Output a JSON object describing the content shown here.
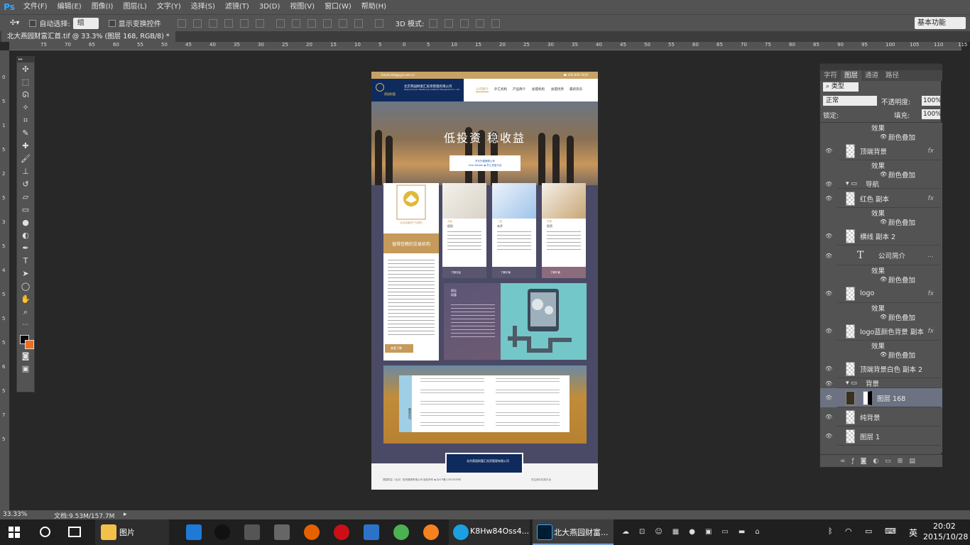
{
  "menubar": {
    "logo": "Ps",
    "items": [
      "文件(F)",
      "编辑(E)",
      "图像(I)",
      "图层(L)",
      "文字(Y)",
      "选择(S)",
      "滤镜(T)",
      "3D(D)",
      "视图(V)",
      "窗口(W)",
      "帮助(H)"
    ]
  },
  "options": {
    "auto_select_label": "自动选择:",
    "auto_select_value": "组",
    "show_transform_label": "显示变换控件",
    "mode_3d_label": "3D 模式:",
    "workspace": "基本功能"
  },
  "document_tab": "北大燕园财富汇首.tif @ 33.3% (图层 168, RGB/8) *",
  "ruler": {
    "h_ticks": [
      "75",
      "70",
      "65",
      "60",
      "55",
      "50",
      "45",
      "40",
      "35",
      "30",
      "25",
      "20",
      "15",
      "10",
      "5",
      "0",
      "5",
      "10",
      "15",
      "20",
      "25",
      "30",
      "35",
      "40",
      "45",
      "50",
      "55",
      "60",
      "65",
      "70",
      "75",
      "80",
      "85",
      "90",
      "95",
      "100",
      "105",
      "110",
      "115",
      "120"
    ],
    "v_ticks": [
      "0",
      "5",
      "1",
      "5",
      "2",
      "5",
      "3",
      "5",
      "4",
      "5",
      "5",
      "5",
      "6",
      "5",
      "7",
      "5"
    ]
  },
  "design": {
    "top_email": "Email:info@yyjr.com.cn",
    "top_phone": "☎ 400-600-1919",
    "logo_cn": "北京燕园财富汇投资管理有限公司",
    "logo_en": "Beijing Yanyuan Wealthsong Investment Management Co., Ltd.",
    "logo_mark": "燕园财富",
    "nav": [
      "公司简介",
      "外汇机构",
      "产品简介",
      "加盟机构",
      "加盟优势",
      "最新资讯"
    ],
    "hero_title": "低投资  稳收益",
    "hero_box_line1": "开元外盘借款公司",
    "hero_box_line2": "Viva Wealth ◆ 外汇资金平台",
    "left_band": "值得信赖的交易机构",
    "left_logo_caption": "北京金融资产交易所",
    "left_button": "查看了解",
    "cards": [
      {
        "tag": "共赢",
        "title": "低投",
        "button": "了解共赢"
      },
      {
        "tag": "二线",
        "title": "未开",
        "button": "了解平衡"
      },
      {
        "tag": "开放",
        "title": "投资",
        "button": "了解平衡"
      }
    ],
    "dark_title": "理念",
    "dark_sub": "财富",
    "news_side": "最新资讯",
    "footer_company_cn": "北京燕园财富汇投资管理有限公司",
    "footer_line": "燕园财富（北京）投资管理有限公司  版权所有  ◆ 京ICP备12345678号",
    "footer_right": "关注我们在线平台"
  },
  "panel": {
    "tabs": [
      "字符",
      "图层",
      "通道",
      "路径"
    ],
    "active_tab": "图层",
    "filter_kind": "类型",
    "blend_mode": "正常",
    "opacity_label": "不透明度:",
    "opacity": "100%",
    "lock_label": "锁定:",
    "fill_label": "填充:",
    "fill": "100%",
    "layers": [
      {
        "name": "效果",
        "kind": "effects-header"
      },
      {
        "name": "颜色叠加",
        "kind": "effect"
      },
      {
        "name": "顶端背景",
        "kind": "layer",
        "fx": "fx"
      },
      {
        "name": "效果",
        "kind": "effects-header"
      },
      {
        "name": "颜色叠加",
        "kind": "effect"
      },
      {
        "name": "导航",
        "kind": "group"
      },
      {
        "name": "红色 副本",
        "kind": "layer",
        "fx": "fx"
      },
      {
        "name": "效果",
        "kind": "effects-header"
      },
      {
        "name": "颜色叠加",
        "kind": "effect"
      },
      {
        "name": "横线 副本 2",
        "kind": "layer"
      },
      {
        "name": "公司简介",
        "kind": "text",
        "fx": "..."
      },
      {
        "name": "效果",
        "kind": "effects-header"
      },
      {
        "name": "颜色叠加",
        "kind": "effect"
      },
      {
        "name": "logo",
        "kind": "layer",
        "fx": "fx"
      },
      {
        "name": "效果",
        "kind": "effects-header"
      },
      {
        "name": "颜色叠加",
        "kind": "effect"
      },
      {
        "name": "logo蓝颜色背景 副本",
        "kind": "layer",
        "fx": "fx"
      },
      {
        "name": "效果",
        "kind": "effects-header"
      },
      {
        "name": "颜色叠加",
        "kind": "effect"
      },
      {
        "name": "顶端背景白色 副本 2",
        "kind": "layer"
      },
      {
        "name": "背景",
        "kind": "group"
      },
      {
        "name": "图层 168",
        "kind": "layer-selected"
      },
      {
        "name": "纯背景",
        "kind": "layer"
      },
      {
        "name": "图层 1",
        "kind": "layer"
      }
    ]
  },
  "status": {
    "zoom": "33.33%",
    "doc_size": "文档:9.53M/157.7M"
  },
  "taskbar": {
    "apps": [
      "图片",
      "K8Hw84Oss4...",
      "北大燕园财富..."
    ],
    "ime": "英",
    "time": "20:02",
    "date": "2015/10/28"
  },
  "colors": {
    "foreground": "#0a0a0a",
    "background": "#f06d21",
    "accent_gold": "#c59a5b",
    "navy": "#0f2a5c"
  }
}
